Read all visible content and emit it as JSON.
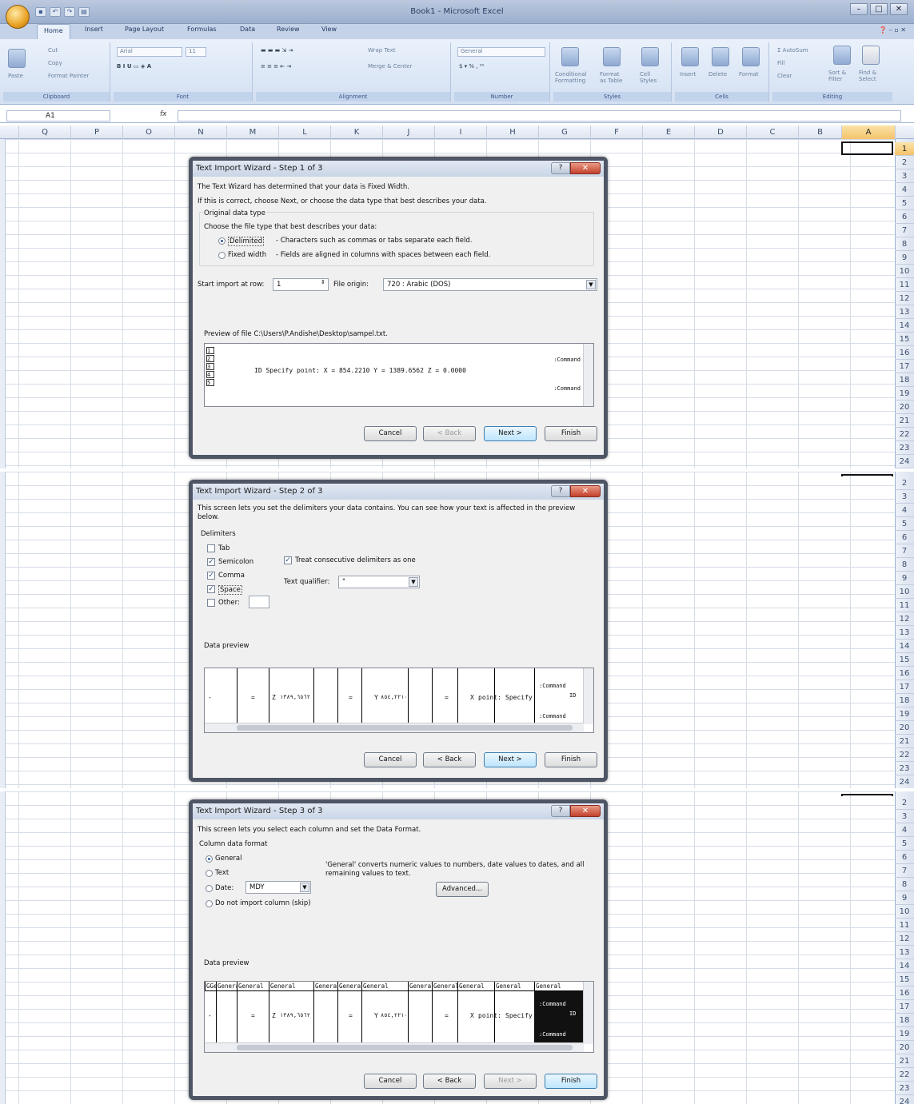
{
  "window": {
    "title": "Book1 - Microsoft Excel"
  },
  "tabs": [
    "Home",
    "Insert",
    "Page Layout",
    "Formulas",
    "Data",
    "Review",
    "View"
  ],
  "ribbon": {
    "clipboard": {
      "label": "Clipboard",
      "paste": "Paste",
      "cut": "Cut",
      "copy": "Copy",
      "format_painter": "Format Painter"
    },
    "font": {
      "label": "Font",
      "name": "Arial",
      "size": "11"
    },
    "alignment": {
      "label": "Alignment",
      "wrap": "Wrap Text",
      "merge": "Merge & Center"
    },
    "number": {
      "label": "Number",
      "format": "General"
    },
    "styles": {
      "label": "Styles",
      "cond": "Conditional Formatting",
      "table": "Format as Table",
      "cell": "Cell Styles"
    },
    "cells": {
      "label": "Cells",
      "insert": "Insert",
      "delete": "Delete",
      "format": "Format"
    },
    "editing": {
      "label": "Editing",
      "autosum": "AutoSum",
      "fill": "Fill",
      "clear": "Clear",
      "sort": "Sort & Filter",
      "find": "Find & Select"
    }
  },
  "formula_bar": {
    "name_box": "A1",
    "fx": "fx"
  },
  "columns": [
    "Q",
    "P",
    "O",
    "N",
    "M",
    "L",
    "K",
    "J",
    "I",
    "H",
    "G",
    "F",
    "E",
    "D",
    "C",
    "B",
    "A"
  ],
  "rows1": [
    "1",
    "2",
    "3",
    "4",
    "5",
    "6",
    "7",
    "8",
    "9",
    "10",
    "11",
    "12",
    "13",
    "14",
    "15",
    "16",
    "17",
    "18",
    "19",
    "20",
    "21",
    "22",
    "23",
    "24"
  ],
  "rows2": [
    "2",
    "3",
    "4",
    "5",
    "6",
    "7",
    "8",
    "9",
    "10",
    "11",
    "12",
    "13",
    "14",
    "15",
    "16",
    "17",
    "18",
    "19",
    "20",
    "21",
    "22",
    "23",
    "24"
  ],
  "rows3": [
    "2",
    "3",
    "4",
    "5",
    "6",
    "7",
    "8",
    "9",
    "10",
    "11",
    "12",
    "13",
    "14",
    "15",
    "16",
    "17",
    "18",
    "19",
    "20",
    "21",
    "22",
    "23",
    "24"
  ],
  "step1": {
    "title": "Text Import Wizard - Step 1 of 3",
    "line1": "The Text Wizard has determined that your data is Fixed Width.",
    "line2": "If this is correct, choose Next, or choose the data type that best describes your data.",
    "group_label": "Original data type",
    "choose": "Choose the file type that best describes your data:",
    "delimited": "Delimited",
    "delimited_desc": "- Characters such as commas or tabs separate each field.",
    "fixed": "Fixed width",
    "fixed_desc": "- Fields are aligned in columns with spaces between each field.",
    "start_row_label": "Start import at row:",
    "start_row_value": "1",
    "origin_label": "File origin:",
    "origin_value": "720 : Arabic (DOS)",
    "preview_label": "Preview of file C:\\Users\\P.Andishe\\Desktop\\sampel.txt.",
    "preview_lines": [
      "1",
      "2",
      "3",
      "4",
      "5"
    ],
    "preview_cmd1": ":Command",
    "preview_data": "ID Specify point:  X = 854.2210      Y = 1389.6562      Z = 0.0000",
    "preview_cmd2": ":Command",
    "buttons": {
      "cancel": "Cancel",
      "back": "< Back",
      "next": "Next >",
      "finish": "Finish"
    }
  },
  "step2": {
    "title": "Text Import Wizard - Step 2 of 3",
    "desc": "This screen lets you set the delimiters your data contains.  You can see how your text is affected in the preview below.",
    "delim_label": "Delimiters",
    "tab": "Tab",
    "semicolon": "Semicolon",
    "comma": "Comma",
    "space": "Space",
    "other": "Other:",
    "consecutive": "Treat consecutive delimiters as one",
    "qualifier_label": "Text qualifier:",
    "qualifier_value": "\"",
    "preview_label": "Data preview",
    "preview_cmd1": ":Command",
    "preview_id": "ID",
    "preview_cmd2": ":Command",
    "cells": [
      "=",
      "Z",
      "١٣٨٩,٦٥٦٢",
      "=",
      "Y",
      "٨٥٤,٢٢١٠",
      "=",
      "X",
      "point:",
      "Specify"
    ],
    "buttons": {
      "cancel": "Cancel",
      "back": "< Back",
      "next": "Next >",
      "finish": "Finish"
    }
  },
  "step3": {
    "title": "Text Import Wizard - Step 3 of 3",
    "desc": "This screen lets you select each column and set the Data Format.",
    "group_label": "Column data format",
    "general": "General",
    "text": "Text",
    "date": "Date:",
    "date_value": "MDY",
    "skip": "Do not import column (skip)",
    "info": "'General' converts numeric values to numbers, date values to dates, and all remaining values to text.",
    "advanced": "Advanced...",
    "preview_label": "Data preview",
    "headers": [
      "GGeneral",
      "General",
      "General",
      "General",
      "General",
      "General",
      "General",
      "General",
      "General",
      "General",
      "General",
      "General"
    ],
    "preview_cmd1": ":Command",
    "preview_id": "ID",
    "preview_cmd2": ":Command",
    "cells": [
      "=",
      "Z",
      "١٣٨٩,٦٥٦٢",
      "=",
      "Y",
      "٨٥٤,٢٢١٠",
      "=",
      "X",
      "point:",
      "Specify"
    ],
    "buttons": {
      "cancel": "Cancel",
      "back": "< Back",
      "next": "Next >",
      "finish": "Finish"
    }
  }
}
